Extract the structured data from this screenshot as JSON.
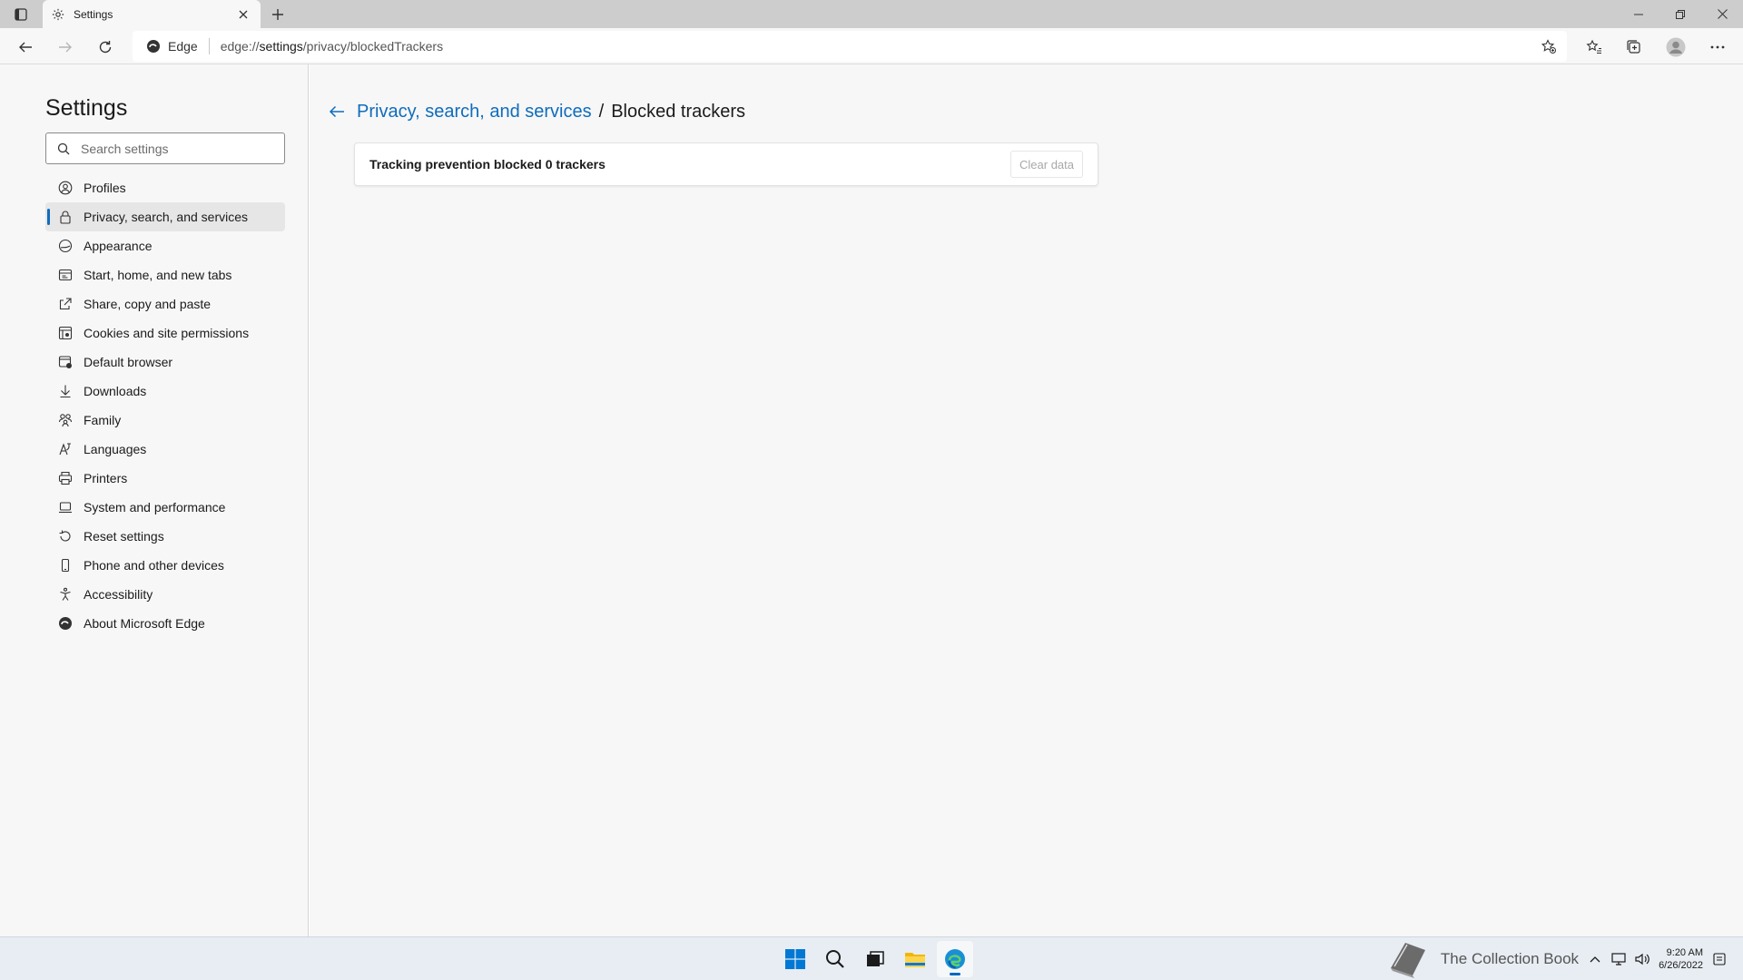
{
  "browser": {
    "tab_title": "Settings",
    "address_chip": "Edge",
    "url_prefix": "edge://",
    "url_host": "settings",
    "url_path": "/privacy/blockedTrackers"
  },
  "sidebar": {
    "title": "Settings",
    "search_placeholder": "Search settings",
    "items": [
      {
        "label": "Profiles",
        "icon": "profile-icon"
      },
      {
        "label": "Privacy, search, and services",
        "icon": "lock-icon"
      },
      {
        "label": "Appearance",
        "icon": "appearance-icon"
      },
      {
        "label": "Start, home, and new tabs",
        "icon": "home-tabs-icon"
      },
      {
        "label": "Share, copy and paste",
        "icon": "share-icon"
      },
      {
        "label": "Cookies and site permissions",
        "icon": "cookies-icon"
      },
      {
        "label": "Default browser",
        "icon": "browser-icon"
      },
      {
        "label": "Downloads",
        "icon": "download-icon"
      },
      {
        "label": "Family",
        "icon": "family-icon"
      },
      {
        "label": "Languages",
        "icon": "languages-icon"
      },
      {
        "label": "Printers",
        "icon": "printer-icon"
      },
      {
        "label": "System and performance",
        "icon": "laptop-icon"
      },
      {
        "label": "Reset settings",
        "icon": "reset-icon"
      },
      {
        "label": "Phone and other devices",
        "icon": "phone-icon"
      },
      {
        "label": "Accessibility",
        "icon": "accessibility-icon"
      },
      {
        "label": "About Microsoft Edge",
        "icon": "edge-icon"
      }
    ],
    "active_index": 1
  },
  "main": {
    "breadcrumb_parent": "Privacy, search, and services",
    "breadcrumb_separator": "/",
    "breadcrumb_current": "Blocked trackers",
    "tracking_message": "Tracking prevention blocked 0 trackers",
    "clear_button": "Clear data"
  },
  "taskbar": {
    "watermark": "The Collection Book",
    "time": "9:20 AM",
    "date": "6/26/2022"
  },
  "colors": {
    "accent": "#0f6cbd",
    "sidebar_bg": "#f7f7f7",
    "taskbar_bg": "#e7edf3"
  }
}
